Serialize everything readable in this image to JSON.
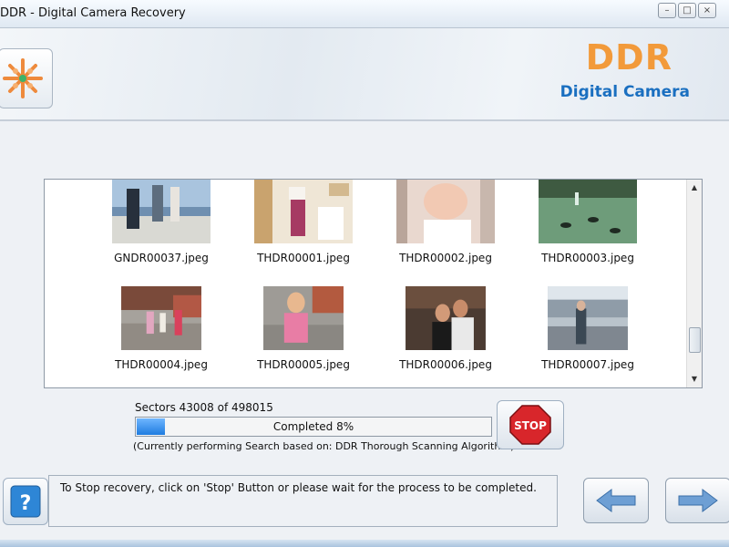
{
  "window": {
    "title": "DDR - Digital Camera Recovery",
    "buttons": {
      "minimize": "–",
      "maximize": "□",
      "close": "×"
    }
  },
  "header": {
    "brand": "DDR",
    "subtitle": "Digital Camera",
    "logo_icon": "asterisk-logo-icon"
  },
  "files": [
    {
      "name": "GNDR00037.jpeg"
    },
    {
      "name": "THDR00001.jpeg"
    },
    {
      "name": "THDR00002.jpeg"
    },
    {
      "name": "THDR00003.jpeg"
    },
    {
      "name": "THDR00004.jpeg"
    },
    {
      "name": "THDR00005.jpeg"
    },
    {
      "name": "THDR00006.jpeg"
    },
    {
      "name": "THDR00007.jpeg"
    }
  ],
  "scan": {
    "sectors_text": "Sectors  43008 of 498015",
    "progress_text": "Completed 8%",
    "progress_fraction": 0.08,
    "algorithm_text": "(Currently performing Search based on:  DDR Thorough Scanning Algorithm)"
  },
  "buttons": {
    "stop_label": "STOP",
    "help_label": "?",
    "back_icon": "arrow-left-icon",
    "next_icon": "arrow-right-icon"
  },
  "status": {
    "message": "To Stop recovery, click on 'Stop' Button or please wait for the process to be completed."
  },
  "colors": {
    "brand": "#f29a3a",
    "subtitle": "#1a6fc0",
    "progress": "#1f7ce0",
    "stop": "#d8262b"
  }
}
